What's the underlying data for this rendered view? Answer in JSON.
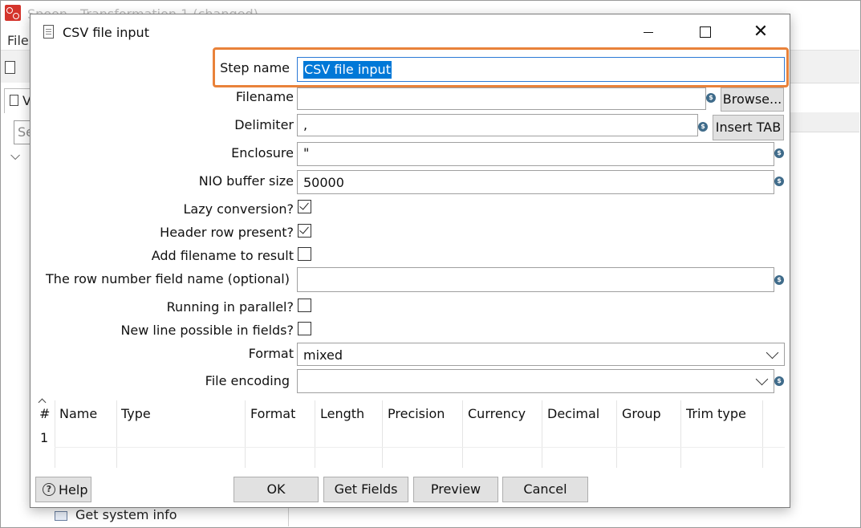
{
  "background_window": {
    "title": "Spoon - Transformation 1 (changed)",
    "menu_file": "File",
    "tab_label": "V",
    "search_placeholder": "Se",
    "tree_item": "Get system info"
  },
  "dialog": {
    "title": "CSV file input",
    "step_name_label": "Step name",
    "step_name_value": "CSV file input",
    "filename_label": "Filename",
    "filename_value": "",
    "browse_button": "Browse...",
    "delimiter_label": "Delimiter",
    "delimiter_value": ",",
    "insert_tab_button": "Insert TAB",
    "enclosure_label": "Enclosure",
    "enclosure_value": "\"",
    "nio_label": "NIO buffer size",
    "nio_value": "50000",
    "lazy_label": "Lazy conversion?",
    "lazy_checked": true,
    "header_label": "Header row present?",
    "header_checked": true,
    "add_filename_label": "Add filename to result",
    "add_filename_checked": false,
    "row_number_label": "The row number field name (optional)",
    "row_number_value": "",
    "parallel_label": "Running in parallel?",
    "parallel_checked": false,
    "newline_label": "New line possible in fields?",
    "newline_checked": false,
    "format_label": "Format",
    "format_value": "mixed",
    "encoding_label": "File encoding",
    "encoding_value": "",
    "var_icon": "$",
    "fields_table": {
      "columns": [
        "#",
        "Name",
        "Type",
        "Format",
        "Length",
        "Precision",
        "Currency",
        "Decimal",
        "Group",
        "Trim type"
      ],
      "rows": [
        [
          "1",
          "",
          "",
          "",
          "",
          "",
          "",
          "",
          "",
          ""
        ]
      ]
    },
    "help_button": "Help",
    "ok_button": "OK",
    "get_fields_button": "Get Fields",
    "preview_button": "Preview",
    "cancel_button": "Cancel"
  },
  "colors": {
    "highlight": "#e9823a",
    "selection": "#0078d7",
    "variable_icon": "#3f6b8a"
  }
}
